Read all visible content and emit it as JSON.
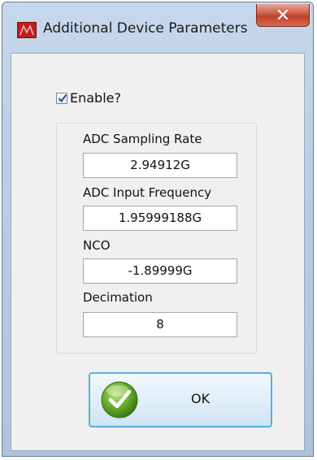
{
  "window": {
    "title": "Additional Device Parameters",
    "app_icon": "red-square-icon",
    "close_icon": "close-x-icon"
  },
  "enable": {
    "label": "Enable?",
    "checked": true
  },
  "fields": [
    {
      "label": "ADC Sampling Rate",
      "value": "2.94912G"
    },
    {
      "label": "ADC Input  Frequency",
      "value": "1.95999188G"
    },
    {
      "label": "NCO",
      "value": "-1.89999G"
    },
    {
      "label": "Decimation",
      "value": "8"
    }
  ],
  "ok_button": {
    "label": "OK",
    "icon": "green-check-icon"
  },
  "colors": {
    "titlebar": "#b9cde4",
    "client": "#f0f0f0",
    "close": "#c2402a",
    "ok_border": "#56aee4",
    "check_green": "#4f9a1e"
  }
}
